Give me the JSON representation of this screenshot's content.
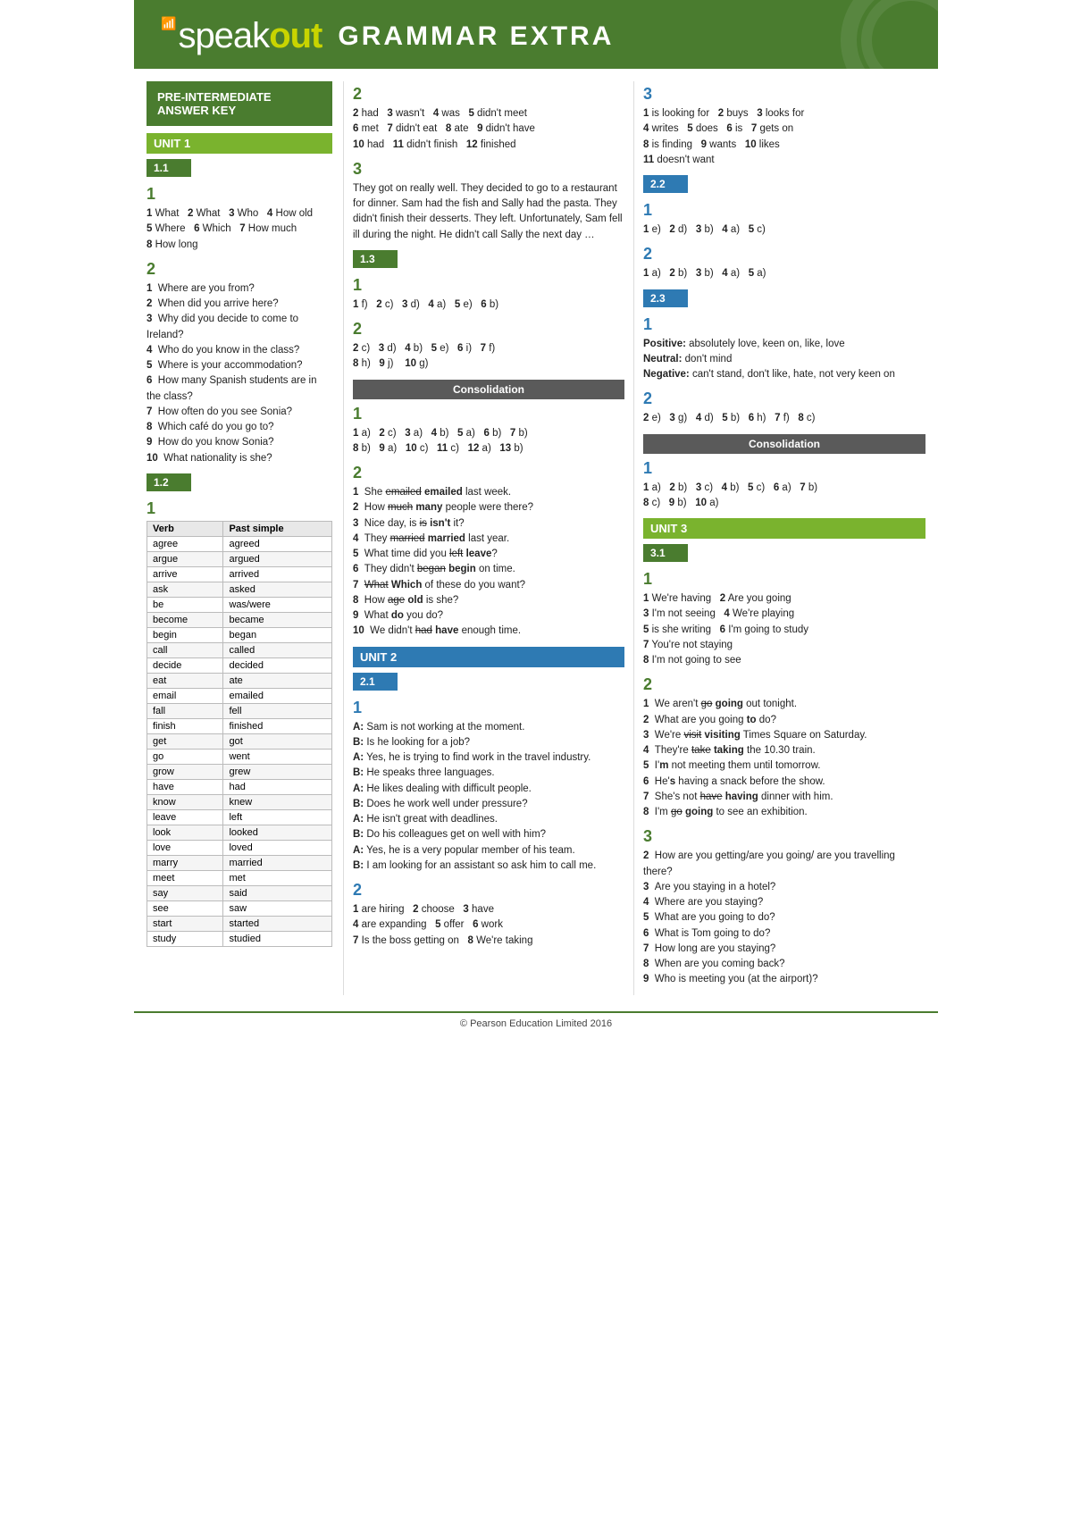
{
  "header": {
    "logo_speak": "speak",
    "logo_out": "out",
    "title": "GRAMMAR EXTRA",
    "wifi": "((•))"
  },
  "left": {
    "answer_key_label": "PRE-INTERMEDIATE ANSWER KEY",
    "unit1_label": "UNIT 1",
    "u1_1_label": "1.1",
    "u1_1_sec1_label": "1",
    "u1_1_sec1_content": "1 What   2 What   3 Who   4 How old\n5 Where   6 Which   7 How much\n8 How long",
    "u1_1_sec2_label": "2",
    "u1_1_sec2_items": [
      "1  Where are you from?",
      "2  When did you arrive here?",
      "3  Why did you decide to come to Ireland?",
      "4  Who do you know in the class?",
      "5  Where is your accommodation?",
      "6  How many Spanish students are in the class?",
      "7  How often do you see Sonia?",
      "8  Which café do you go to?",
      "9  How do you know Sonia?",
      "10  What nationality is she?"
    ],
    "u1_2_label": "1.2",
    "u1_2_sec1_label": "1",
    "verb_table_headers": [
      "Verb",
      "Past simple"
    ],
    "verb_table_rows": [
      [
        "agree",
        "agreed"
      ],
      [
        "argue",
        "argued"
      ],
      [
        "arrive",
        "arrived"
      ],
      [
        "ask",
        "asked"
      ],
      [
        "be",
        "was/were"
      ],
      [
        "become",
        "became"
      ],
      [
        "begin",
        "began"
      ],
      [
        "call",
        "called"
      ],
      [
        "decide",
        "decided"
      ],
      [
        "eat",
        "ate"
      ],
      [
        "email",
        "emailed"
      ],
      [
        "fall",
        "fell"
      ],
      [
        "finish",
        "finished"
      ],
      [
        "get",
        "got"
      ],
      [
        "go",
        "went"
      ],
      [
        "grow",
        "grew"
      ],
      [
        "have",
        "had"
      ],
      [
        "know",
        "knew"
      ],
      [
        "leave",
        "left"
      ],
      [
        "look",
        "looked"
      ],
      [
        "love",
        "loved"
      ],
      [
        "marry",
        "married"
      ],
      [
        "meet",
        "met"
      ],
      [
        "say",
        "said"
      ],
      [
        "see",
        "saw"
      ],
      [
        "start",
        "started"
      ],
      [
        "study",
        "studied"
      ]
    ]
  },
  "middle": {
    "sec2_label": "2",
    "sec2_content": "2 had   3 wasn't   4 was   5 didn't meet\n6 met   7 didn't eat   8 ate   9 didn't have\n10 had   11 didn't finish   12 finished",
    "sec3_label": "3",
    "sec3_paragraph": "They got on really well. They decided to go to a restaurant for dinner. Sam had the fish and Sally had the pasta. They didn't finish their desserts. They left. Unfortunately, Sam fell ill during the night. He didn't call Sally the next day …",
    "u1_3_label": "1.3",
    "u1_3_sec1_label": "1",
    "u1_3_sec1_content": "1 f)   2 c)   3 d)   4 a)   5 e)   6 b)",
    "u1_3_sec2_label": "2",
    "u1_3_sec2_content": "2 c)   3 d)   4 b)   5 e)   6 i)   7 f)\n8 h)   9 j)   10 g)",
    "consolidation_label": "Consolidation",
    "consol_sec1_label": "1",
    "consol_sec1_content": "1 a)   2 c)   3 a)   4 b)   5 a)   6 b)   7 b)\n8 b)   9 a)   10 c)   11 c)   12 a)   13 b)",
    "consol_sec2_label": "2",
    "consol_sec2_items": [
      {
        "num": "1",
        "strike": "emailed",
        "bold": "emailed",
        "rest": " last week."
      },
      {
        "num": "2",
        "strike": "much",
        "bold": "many",
        "rest": " people were there?"
      },
      {
        "num": "3",
        "plain": "Nice day, is ",
        "strike": "is",
        "bold": "isn't",
        "rest": " it?"
      },
      {
        "num": "4",
        "strike": "married",
        "bold": "married",
        "rest": " last year."
      },
      {
        "num": "5",
        "plain": "What time did you ",
        "strike": "left",
        "bold": "leave",
        "rest": "?"
      },
      {
        "num": "6",
        "plain": "They didn't ",
        "strike": "began",
        "bold": "begin",
        "rest": " on time."
      },
      {
        "num": "7",
        "strike": "What",
        "bold": "Which",
        "rest": " of these do you want?"
      },
      {
        "num": "8",
        "plain": "How ",
        "strike": "age",
        "bold": "old",
        "rest": " is she?"
      },
      {
        "num": "9",
        "plain": "What ",
        "bold": "do",
        "rest": " you do?"
      },
      {
        "num": "10",
        "plain": "We didn't ",
        "strike": "had",
        "bold": "have",
        "rest": " enough time."
      }
    ],
    "unit2_label": "UNIT 2",
    "u2_1_label": "2.1",
    "u2_1_sec1_label": "1",
    "u2_1_dialog": [
      "A: Sam is not working at the moment.",
      "B: Is he looking for a job?",
      "A: Yes, he is trying to find work in the travel industry.",
      "B: He speaks three languages.",
      "A: He likes dealing with difficult people.",
      "B: Does he work well under pressure?",
      "A: He isn't great with deadlines.",
      "B: Do his colleagues get on well with him?",
      "A: Yes, he is a very popular member of his team.",
      "B: I am looking for an assistant so ask him to call me."
    ],
    "u2_1_sec2_label": "2",
    "u2_1_sec2_content": "1 are hiring   2 choose   3 have\n4 are expanding   5 offer   6 work\n7 Is the boss getting on   8 We're taking"
  },
  "right": {
    "sec3_label": "3",
    "sec3_content": "1 is looking for   2 buys   3 looks for\n4 writes   5 does   6 is   7 gets on\n8 is finding   9 wants   10 likes\n11 doesn't want",
    "u2_2_label": "2.2",
    "u2_2_sec1_label": "1",
    "u2_2_sec1_content": "1 e)   2 d)   3 b)   4 a)   5 c)",
    "u2_2_sec2_label": "2",
    "u2_2_sec2_content": "1 a)   2 b)   3 b)   4 a)   5 a)",
    "u2_3_label": "2.3",
    "u2_3_sec1_label": "1",
    "u2_3_positive_label": "Positive:",
    "u2_3_positive": "absolutely love, keen on, like, love",
    "u2_3_neutral_label": "Neutral:",
    "u2_3_neutral": "don't mind",
    "u2_3_negative_label": "Negative:",
    "u2_3_negative": "can't stand, don't like, hate, not very keen on",
    "u2_3_sec2_label": "2",
    "u2_3_sec2_content": "2 e)   3 g)   4 d)   5 b)   6 h)   7 f)   8 c)",
    "consol2_label": "Consolidation",
    "consol2_sec1_label": "1",
    "consol2_sec1_content": "1 a)   2 b)   3 c)   4 b)   5 c)   6 a)   7 b)\n8 c)   9 b)   10 a)",
    "unit3_label": "UNIT 3",
    "u3_1_label": "3.1",
    "u3_1_sec1_label": "1",
    "u3_1_sec1_content": "1 We're having   2 Are you going\n3 I'm not seeing   4 We're playing\n5 is she writing   6 I'm going to study\n7 You're not staying\n8 I'm not going to see",
    "u3_1_sec2_label": "2",
    "u3_1_sec2_items": [
      {
        "num": "1",
        "plain": "We aren't ",
        "strike": "go",
        "bold": "going",
        "rest": " out tonight."
      },
      {
        "num": "2",
        "plain": "What are you going ",
        "bold": "to",
        "rest": " do?"
      },
      {
        "num": "3",
        "plain": "We're ",
        "strike": "visit",
        "bold": "visiting",
        "rest": " Times Square on Saturday."
      },
      {
        "num": "4",
        "plain": "They're ",
        "strike": "take",
        "bold": "taking",
        "rest": " the 10.30 train."
      },
      {
        "num": "5",
        "plain": "I'",
        "bold": "m",
        "rest": " not meeting them until tomorrow."
      },
      {
        "num": "6",
        "plain": "He'",
        "bold": "s",
        "rest": " having a snack before the show."
      },
      {
        "num": "7",
        "plain": "She's not ",
        "strike": "have",
        "bold": "having",
        "rest": " dinner with him."
      },
      {
        "num": "8",
        "plain": "I'm ",
        "strike": "go",
        "bold": "going",
        "rest": " to see an exhibition."
      }
    ],
    "u3_1_sec3_label": "3",
    "u3_1_sec3_items": [
      "2  How are you getting/are you going/are you travelling there?",
      "3  Are you staying in a hotel?",
      "4  Where are you staying?",
      "5  What are you going to do?",
      "6  What is Tom going to do?",
      "7  How long are you staying?",
      "8  When are you coming back?",
      "9  Who is meeting you (at the airport)?"
    ]
  },
  "footer": {
    "copyright": "© Pearson Education Limited 2016"
  }
}
